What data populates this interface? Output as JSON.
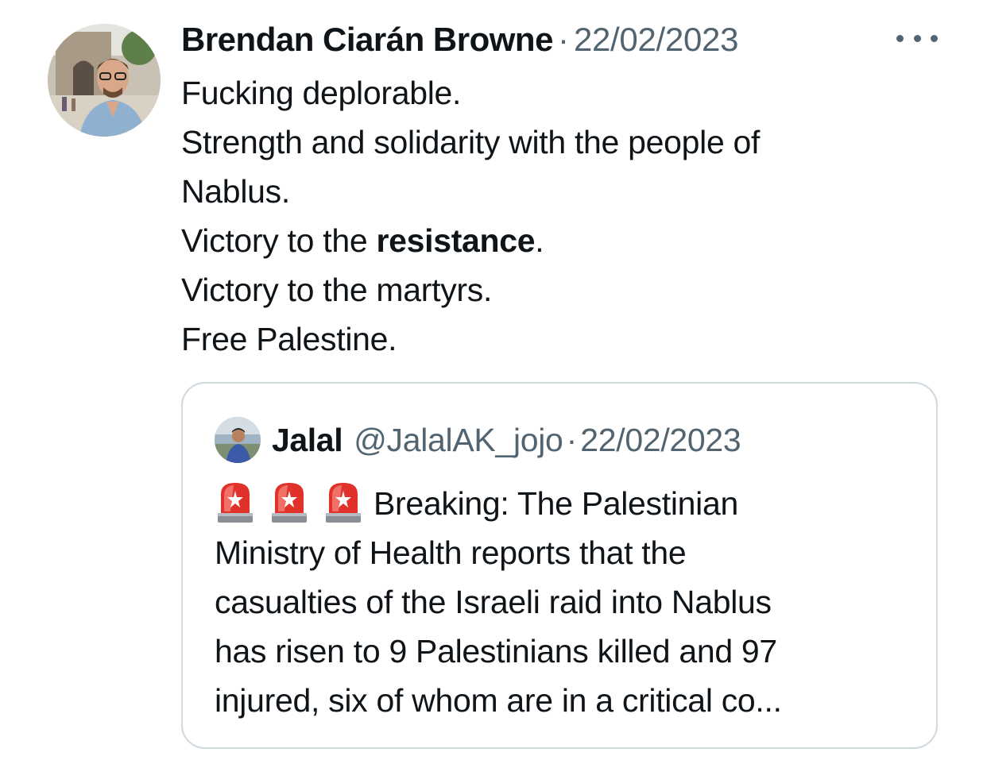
{
  "tweet": {
    "author_name": "Brendan Ciarán Browne",
    "separator": "·",
    "timestamp": "22/02/2023",
    "more_icon": "more-horizontal-icon",
    "lines": [
      "Fucking deplorable.",
      "Strength and solidarity with the people of",
      "Nablus."
    ],
    "line4_prefix": "Victory to the ",
    "line4_bold": "resistance",
    "line4_suffix": ".",
    "line5": "Victory to the martyrs.",
    "line6": "Free Palestine."
  },
  "quoted": {
    "author_name": "Jalal",
    "handle": "@JalalAK_jojo",
    "separator": "·",
    "timestamp": "22/02/2023",
    "emoji": [
      "rotating-light-icon",
      "rotating-light-icon",
      "rotating-light-icon"
    ],
    "line1_text": "Breaking: The Palestinian",
    "lines": [
      "Ministry of Health reports that the",
      "casualties of the Israeli raid into Nablus",
      "has risen to 9 Palestinians killed and 97",
      "injured, six of whom are in a critical co..."
    ]
  },
  "colors": {
    "text": "#0f1419",
    "secondary": "#536471",
    "border": "#cfd9de",
    "siren_red": "#e0312b"
  }
}
